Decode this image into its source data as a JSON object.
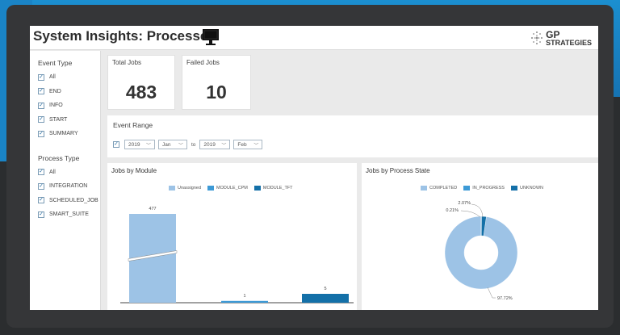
{
  "header": {
    "title": "System Insights: Processes",
    "logo": {
      "line1": "GP",
      "line2": "STRATEGIES"
    }
  },
  "filters": {
    "event_type": {
      "heading": "Event Type",
      "items": [
        {
          "label": "All",
          "checked": true
        },
        {
          "label": "END",
          "checked": true
        },
        {
          "label": "INFO",
          "checked": true
        },
        {
          "label": "START",
          "checked": true
        },
        {
          "label": "SUMMARY",
          "checked": true
        }
      ]
    },
    "process_type": {
      "heading": "Process Type",
      "items": [
        {
          "label": "All",
          "checked": true
        },
        {
          "label": "INTEGRATION",
          "checked": true
        },
        {
          "label": "SCHEDULED_JOB",
          "checked": true
        },
        {
          "label": "SMART_SUITE",
          "checked": true
        }
      ]
    }
  },
  "kpis": {
    "total_jobs": {
      "label": "Total Jobs",
      "value": "483"
    },
    "failed_jobs": {
      "label": "Failed Jobs",
      "value": "10"
    }
  },
  "event_range": {
    "title": "Event Range",
    "from_year": "2019",
    "from_month": "Jan",
    "to_label": "to",
    "to_year": "2019",
    "to_month": "Feb"
  },
  "colors": {
    "unassigned": "#9dc3e6",
    "module_cpm": "#3d9ad6",
    "module_tft": "#1470a8",
    "completed": "#9dc3e6",
    "in_progress": "#3d9ad6",
    "unknown": "#1470a8"
  },
  "jobs_by_module": {
    "title": "Jobs by Module",
    "legend": [
      "Unassigned",
      "MODULE_CPM",
      "MODULE_TFT"
    ]
  },
  "jobs_by_state": {
    "title": "Jobs by Process State",
    "legend": [
      "COMPLETED",
      "IN_PROGRESS",
      "UNKNOWN"
    ]
  },
  "chart_data": [
    {
      "type": "bar",
      "title": "Jobs by Module",
      "categories": [
        "Unassigned",
        "MODULE_CPM",
        "MODULE_TFT"
      ],
      "values": [
        477,
        1,
        5
      ],
      "axis_break": true
    },
    {
      "type": "pie",
      "title": "Jobs by Process State",
      "donut": true,
      "labels": [
        "COMPLETED",
        "IN_PROGRESS",
        "UNKNOWN"
      ],
      "values": [
        97.72,
        0.21,
        2.07
      ],
      "value_labels": [
        "97.72%",
        "0.21%",
        "2.07%"
      ]
    }
  ]
}
